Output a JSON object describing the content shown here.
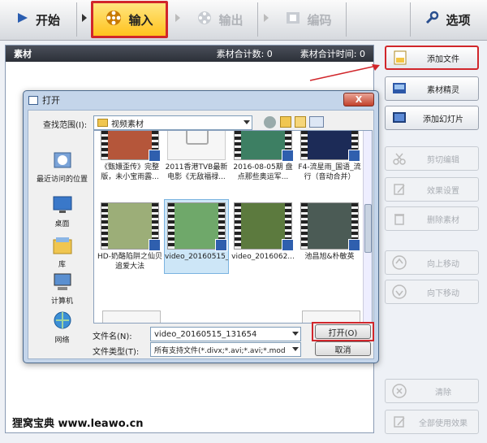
{
  "toolbar": {
    "start": "开始",
    "input": "输入",
    "output": "输出",
    "encode": "编码",
    "options": "选项"
  },
  "panel": {
    "title": "素材",
    "count_label": "素材合计数: 0",
    "time_label": "素材合计时间: 0"
  },
  "right_buttons": [
    "添加文件",
    "素材精灵",
    "添加幻灯片",
    "剪切编辑",
    "效果设置",
    "删除素材",
    "向上移动",
    "向下移动",
    "清除",
    "全部使用效果"
  ],
  "dialog": {
    "title": "打开",
    "close": "X",
    "lookin_label": "查找范围(I):",
    "lookin_value": "视频素材",
    "places": [
      "最近访问的位置",
      "桌面",
      "库",
      "计算机",
      "网络"
    ],
    "files": [
      {
        "name": "《甄嬛歪传》完整版，未小宝雨露...",
        "type": "video"
      },
      {
        "name": "2011香港TVB最新电影《无敌福禄...",
        "type": "generic"
      },
      {
        "name": "2016-08-05期 盘点那些奥运军...",
        "type": "video"
      },
      {
        "name": "F4-流星雨_国语_流行（音动合并）",
        "type": "video"
      },
      {
        "name": "HD-奶酪陷阱之仙贝追爱大法",
        "type": "video"
      },
      {
        "name": "video_20160515_131654",
        "type": "video"
      },
      {
        "name": "video_2016062...",
        "type": "video"
      },
      {
        "name": "池昌旭&朴敏英",
        "type": "video"
      }
    ],
    "filename_label": "文件名(N):",
    "filename_value": "video_20160515_131654",
    "filetype_label": "文件类型(T):",
    "filetype_value": "所有支持文件(*.divx;*.avi;*.avi;*.mod",
    "open_btn": "打开(O)",
    "cancel_btn": "取消"
  },
  "watermark": "狸窝宝典 www.leawo.cn",
  "colors": {
    "highlight": "#d1262b",
    "accent": "#ffc21d"
  }
}
